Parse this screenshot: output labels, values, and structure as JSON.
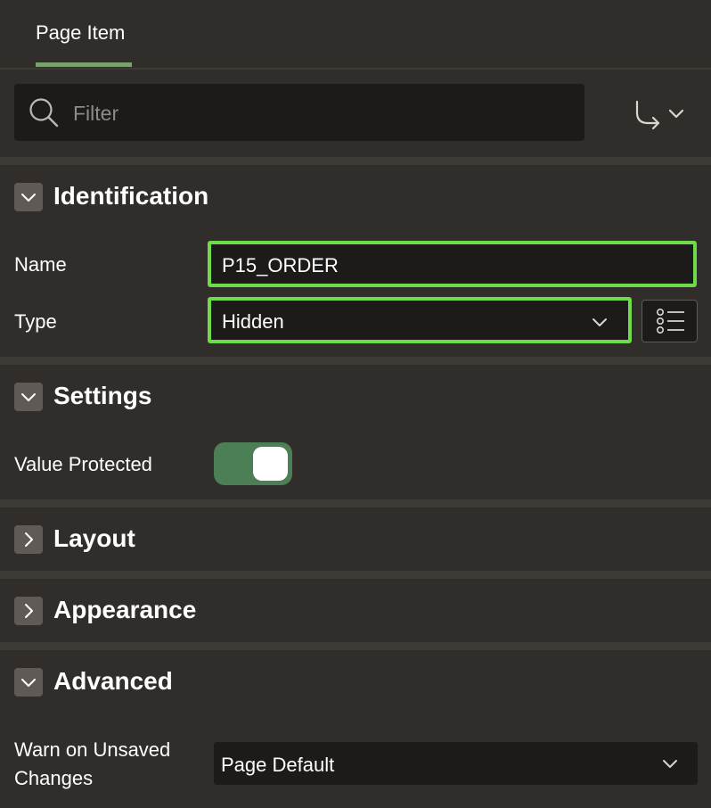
{
  "tabs": [
    {
      "label": "Page Item",
      "active": true
    }
  ],
  "filter": {
    "placeholder": "Filter",
    "value": ""
  },
  "toolbar": {
    "goto_icon": "go-to-group-icon"
  },
  "sections": {
    "identification": {
      "title": "Identification",
      "expanded": true,
      "name_label": "Name",
      "name_value": "P15_ORDER",
      "type_label": "Type",
      "type_value": "Hidden"
    },
    "settings": {
      "title": "Settings",
      "expanded": true,
      "value_protected_label": "Value Protected",
      "value_protected": true
    },
    "layout": {
      "title": "Layout",
      "expanded": false
    },
    "appearance": {
      "title": "Appearance",
      "expanded": false
    },
    "advanced": {
      "title": "Advanced",
      "expanded": true,
      "warn_label_line1": "Warn on Unsaved",
      "warn_label_line2": "Changes",
      "warn_value": "Page Default"
    }
  },
  "colors": {
    "background": "#312d2a",
    "field_background": "#1d1b19",
    "highlight": "#6ddb4a",
    "tab_accent": "#7aa26f",
    "switch_on": "#4d7f56"
  }
}
